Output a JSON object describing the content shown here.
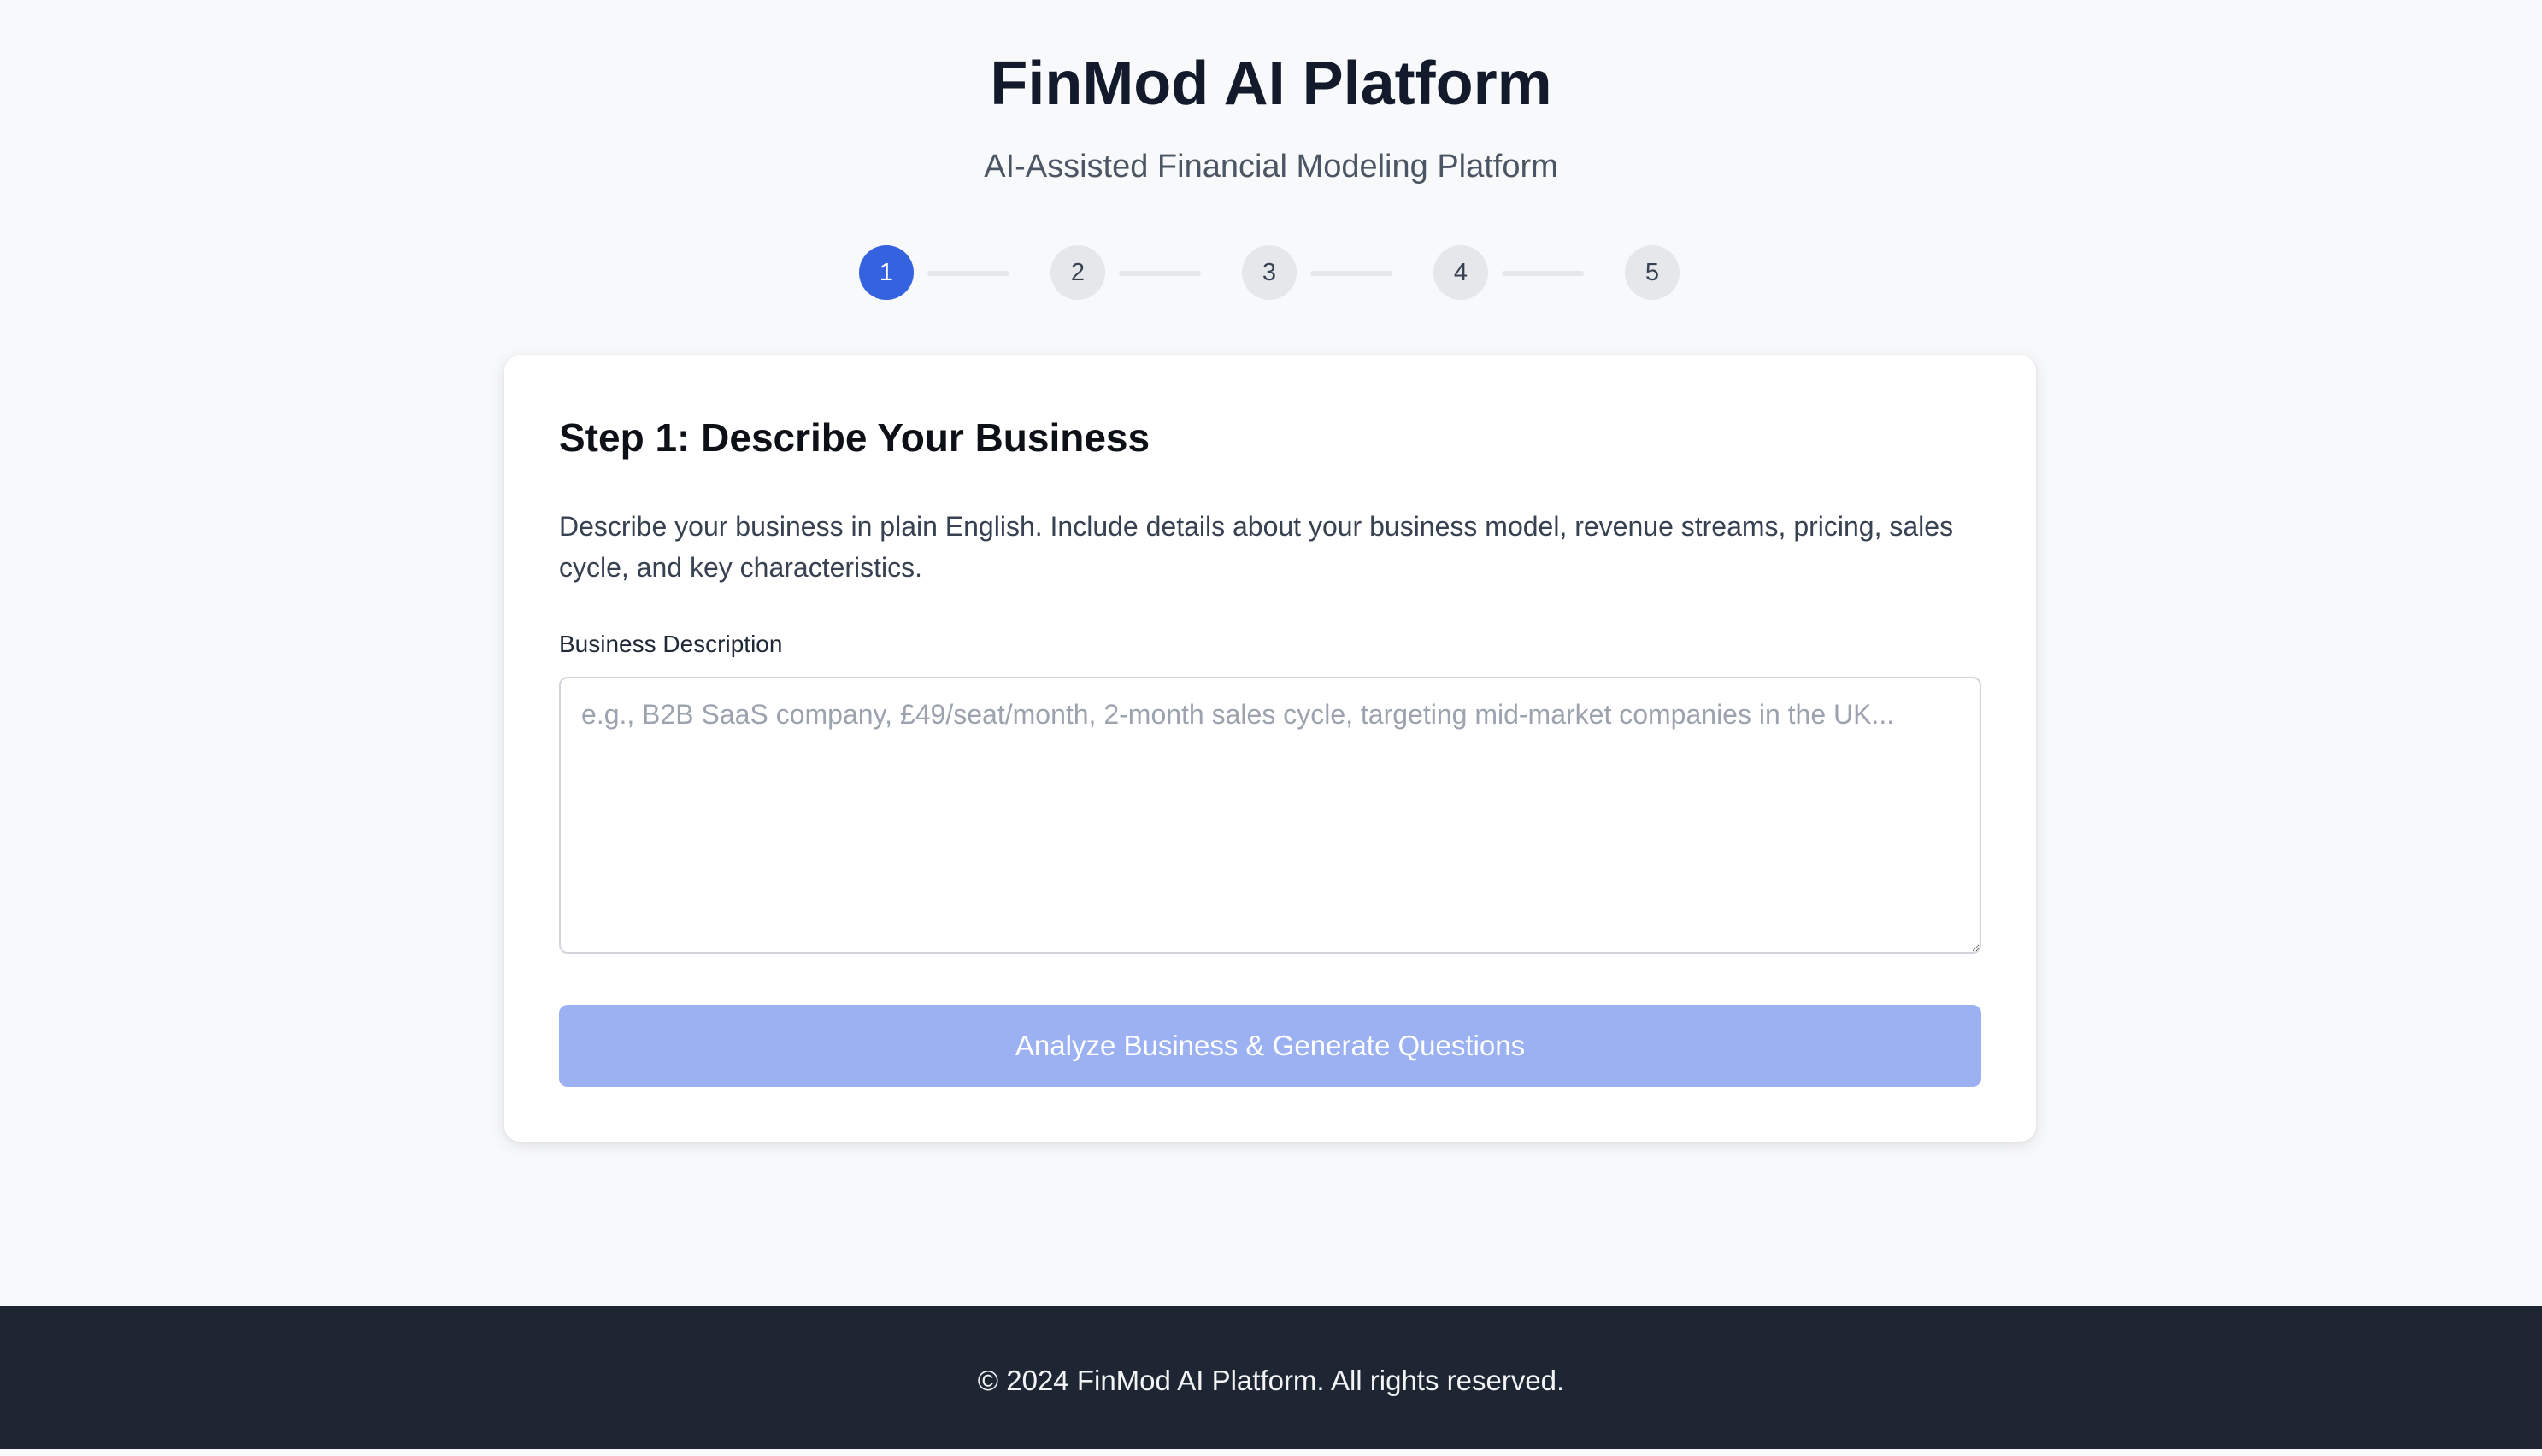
{
  "header": {
    "title": "FinMod AI Platform",
    "subtitle": "AI-Assisted Financial Modeling Platform"
  },
  "stepper": {
    "current_step": 1,
    "steps": [
      {
        "label": "1"
      },
      {
        "label": "2"
      },
      {
        "label": "3"
      },
      {
        "label": "4"
      },
      {
        "label": "5"
      }
    ]
  },
  "step_card": {
    "title": "Step 1: Describe Your Business",
    "description": "Describe your business in plain English. Include details about your business model, revenue streams, pricing, sales cycle, and key characteristics.",
    "field_label": "Business Description",
    "field_value": "",
    "field_placeholder": "e.g., B2B SaaS company, £49/seat/month, 2-month sales cycle, targeting mid-market companies in the UK...",
    "submit_label": "Analyze Business & Generate Questions"
  },
  "footer": {
    "copyright": "© 2024 FinMod AI Platform. All rights reserved."
  },
  "colors": {
    "accent": "#3563e0",
    "button_disabled": "#9cb1f1",
    "footer_bg": "#1f2633",
    "page_bg": "#f8f9fb"
  }
}
